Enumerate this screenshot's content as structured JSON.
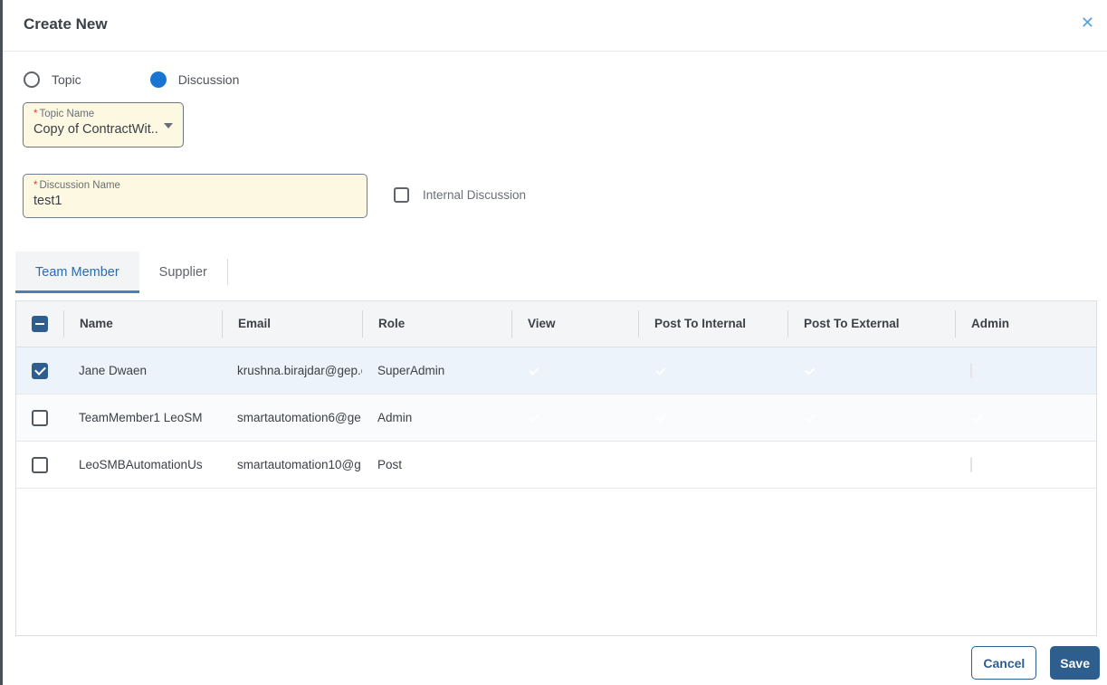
{
  "dialog": {
    "title": "Create New",
    "close_glyph": "✕"
  },
  "required_marker": "*",
  "type_selector": {
    "options": [
      {
        "label": "Topic",
        "selected": false
      },
      {
        "label": "Discussion",
        "selected": true
      }
    ]
  },
  "fields": {
    "topic_name": {
      "label": "Topic Name",
      "required": true,
      "value": "Copy of ContractWit..."
    },
    "discussion_name": {
      "label": "Discussion Name",
      "required": true,
      "value": "test1"
    },
    "internal_discussion": {
      "label": "Internal Discussion",
      "checked": false
    }
  },
  "tabs": [
    {
      "label": "Team Member",
      "active": true
    },
    {
      "label": "Supplier",
      "active": false
    }
  ],
  "table": {
    "select_all_state": "indeterminate",
    "columns": [
      "Name",
      "Email",
      "Role",
      "View",
      "Post To Internal",
      "Post To External",
      "Admin"
    ],
    "rows": [
      {
        "selected": true,
        "name": "Jane Dwaen",
        "email": "krushna.birajdar@gep.c",
        "role": "SuperAdmin",
        "view": true,
        "post_to_internal": true,
        "post_to_external": true,
        "admin": false
      },
      {
        "selected": false,
        "name": "TeamMember1 LeoSM",
        "email": "smartautomation6@ge",
        "role": "Admin",
        "view": true,
        "post_to_internal": true,
        "post_to_external": true,
        "admin": true
      },
      {
        "selected": false,
        "name": "LeoSMBAutomationUs",
        "email": "smartautomation10@g",
        "role": "Post",
        "view": true,
        "post_to_internal": true,
        "post_to_external": true,
        "admin": false
      }
    ]
  },
  "footer": {
    "cancel_label": "Cancel",
    "save_label": "Save"
  },
  "colors": {
    "primary": "#2e5e8e",
    "accent_blue": "#1876d2",
    "field_bg": "#fcf8e2",
    "required_red": "#e03c31",
    "selected_row_bg": "#edf3fa",
    "tab_active_text": "#2a6cab"
  }
}
